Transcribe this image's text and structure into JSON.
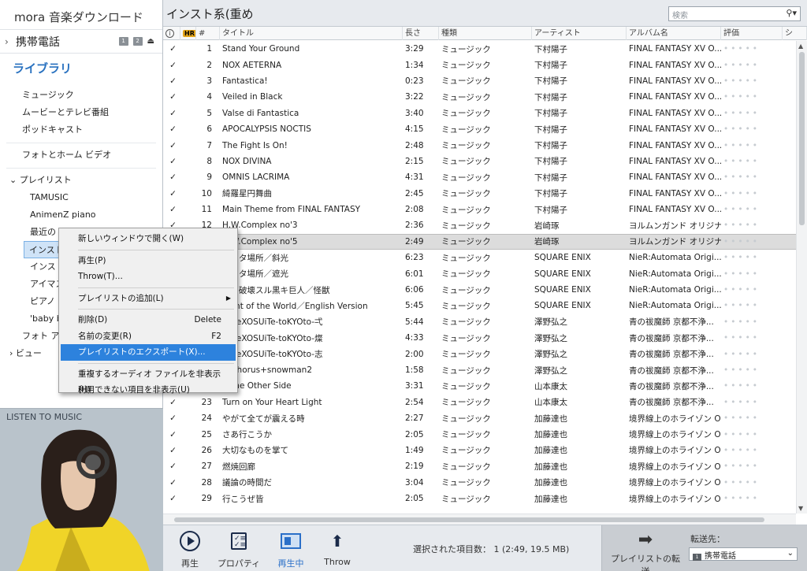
{
  "sidebar": {
    "app_title": "mora 音楽ダウンロード",
    "device": "携帯電話",
    "device_icon_1": "1",
    "device_icon_2": "2",
    "library_heading": "ライブラリ",
    "items": [
      "ミュージック",
      "ムービーとテレビ番組",
      "ポッドキャスト",
      "フォトとホーム ビデオ"
    ],
    "playlist_group": "プレイリスト",
    "playlists": [
      "TAMUSIC",
      "AnimenZ piano",
      "最近の",
      "インスト系",
      "インスト",
      "アイマス",
      "ピアノ",
      "'baby b"
    ],
    "more_items": [
      "フォト アルバ",
      "ビュー"
    ]
  },
  "header": {
    "playlist_title": "インスト系(重め",
    "search_placeholder": "検索"
  },
  "columns": {
    "num": "#",
    "hr": "HR",
    "title": "タイトル",
    "length": "長さ",
    "kind": "種類",
    "artist": "アーティスト",
    "album": "アルバム名",
    "rating": "評価",
    "extra": "シ"
  },
  "tracks": [
    {
      "num": "1",
      "title": "Stand Your Ground",
      "length": "3:29",
      "kind": "ミュージック",
      "artist": "下村陽子",
      "album": "FINAL FANTASY XV O..."
    },
    {
      "num": "2",
      "title": "NOX AETERNA",
      "length": "1:34",
      "kind": "ミュージック",
      "artist": "下村陽子",
      "album": "FINAL FANTASY XV O..."
    },
    {
      "num": "3",
      "title": "Fantastica!",
      "length": "0:23",
      "kind": "ミュージック",
      "artist": "下村陽子",
      "album": "FINAL FANTASY XV O..."
    },
    {
      "num": "4",
      "title": "Veiled in Black",
      "length": "3:22",
      "kind": "ミュージック",
      "artist": "下村陽子",
      "album": "FINAL FANTASY XV O..."
    },
    {
      "num": "5",
      "title": "Valse di Fantastica",
      "length": "3:40",
      "kind": "ミュージック",
      "artist": "下村陽子",
      "album": "FINAL FANTASY XV O..."
    },
    {
      "num": "6",
      "title": "APOCALYPSIS NOCTIS",
      "length": "4:15",
      "kind": "ミュージック",
      "artist": "下村陽子",
      "album": "FINAL FANTASY XV O..."
    },
    {
      "num": "7",
      "title": "The Fight Is On!",
      "length": "2:48",
      "kind": "ミュージック",
      "artist": "下村陽子",
      "album": "FINAL FANTASY XV O..."
    },
    {
      "num": "8",
      "title": "NOX DIVINA",
      "length": "2:15",
      "kind": "ミュージック",
      "artist": "下村陽子",
      "album": "FINAL FANTASY XV O..."
    },
    {
      "num": "9",
      "title": "OMNIS LACRIMA",
      "length": "4:31",
      "kind": "ミュージック",
      "artist": "下村陽子",
      "album": "FINAL FANTASY XV O..."
    },
    {
      "num": "10",
      "title": "綺羅星円舞曲",
      "length": "2:45",
      "kind": "ミュージック",
      "artist": "下村陽子",
      "album": "FINAL FANTASY XV O..."
    },
    {
      "num": "11",
      "title": "Main Theme from FINAL FANTASY",
      "length": "2:08",
      "kind": "ミュージック",
      "artist": "下村陽子",
      "album": "FINAL FANTASY XV O..."
    },
    {
      "num": "12",
      "title": "H.W.Complex no'3",
      "length": "2:36",
      "kind": "ミュージック",
      "artist": "岩崎琢",
      "album": "ヨルムンガンド オリジナル..."
    },
    {
      "num": "",
      "title": "H.W.Complex no'5",
      "length": "2:49",
      "kind": "ミュージック",
      "artist": "岩崎琢",
      "album": "ヨルムンガンド オリジナル..."
    },
    {
      "num": "",
      "title": "サレタ場所／斜光",
      "length": "6:23",
      "kind": "ミュージック",
      "artist": "SQUARE ENIX",
      "album": "NieR:Automata Origi..."
    },
    {
      "num": "",
      "title": "サレタ場所／遮光",
      "length": "6:01",
      "kind": "ミュージック",
      "artist": "SQUARE ENIX",
      "album": "NieR:Automata Origi..."
    },
    {
      "num": "",
      "title": "テラ破壊スル黒キ巨人／怪獣",
      "length": "6:06",
      "kind": "ミュージック",
      "artist": "SQUARE ENIX",
      "album": "NieR:Automata Origi..."
    },
    {
      "num": "",
      "title": "eight of the World／English Version",
      "length": "5:45",
      "kind": "ミュージック",
      "artist": "SQUARE ENIX",
      "album": "NieR:Automata Origi..."
    },
    {
      "num": "",
      "title": "Ue-eXOSUiTe-toKYOto-弌",
      "length": "5:44",
      "kind": "ミュージック",
      "artist": "澤野弘之",
      "album": "青の祓魔師 京都不浄..."
    },
    {
      "num": "",
      "title": "Ue-eXOSUiTe-toKYOto-燦",
      "length": "4:33",
      "kind": "ミュージック",
      "artist": "澤野弘之",
      "album": "青の祓魔師 京都不浄..."
    },
    {
      "num": "",
      "title": "Ue-eXOSUiTe-toKYOto-志",
      "length": "2:00",
      "kind": "ミュージック",
      "artist": "澤野弘之",
      "album": "青の祓魔師 京都不浄..."
    },
    {
      "num": "",
      "title": "osphorus+snowman2",
      "length": "1:58",
      "kind": "ミュージック",
      "artist": "澤野弘之",
      "album": "青の祓魔師 京都不浄..."
    },
    {
      "num": "",
      "title": "N the Other Side",
      "length": "3:31",
      "kind": "ミュージック",
      "artist": "山本康太",
      "album": "青の祓魔師 京都不浄..."
    },
    {
      "num": "23",
      "title": "Turn on Your Heart Light",
      "length": "2:54",
      "kind": "ミュージック",
      "artist": "山本康太",
      "album": "青の祓魔師 京都不浄..."
    },
    {
      "num": "24",
      "title": "やがて全てが震える時",
      "length": "2:27",
      "kind": "ミュージック",
      "artist": "加藤達也",
      "album": "境界線上のホライゾン O..."
    },
    {
      "num": "25",
      "title": "さあ行こうか",
      "length": "2:05",
      "kind": "ミュージック",
      "artist": "加藤達也",
      "album": "境界線上のホライゾン O..."
    },
    {
      "num": "26",
      "title": "大切なものを掌て",
      "length": "1:49",
      "kind": "ミュージック",
      "artist": "加藤達也",
      "album": "境界線上のホライゾン O..."
    },
    {
      "num": "27",
      "title": "燃焼回廊",
      "length": "2:19",
      "kind": "ミュージック",
      "artist": "加藤達也",
      "album": "境界線上のホライゾン O..."
    },
    {
      "num": "28",
      "title": "議論の時間だ",
      "length": "3:04",
      "kind": "ミュージック",
      "artist": "加藤達也",
      "album": "境界線上のホライゾン O..."
    },
    {
      "num": "29",
      "title": "行こうぜ皆",
      "length": "2:05",
      "kind": "ミュージック",
      "artist": "加藤達也",
      "album": "境界線上のホライゾン O..."
    }
  ],
  "context_menu": {
    "items": [
      {
        "label": "新しいウィンドウで開く(W)"
      },
      {
        "label": "再生(P)"
      },
      {
        "label": "Throw(T)..."
      },
      {
        "label": "プレイリストの追加(L)"
      },
      {
        "label": "削除(D)",
        "accel": "Delete"
      },
      {
        "label": "名前の変更(R)",
        "accel": "F2"
      },
      {
        "label": "プレイリストのエクスポート(X)..."
      },
      {
        "label": "重複するオーディオ ファイルを非表示(H)"
      },
      {
        "label": "利用できない項目を非表示(U)"
      }
    ]
  },
  "toolbar": {
    "play": "再生",
    "properties": "プロパティ",
    "now_playing": "再生中",
    "throw": "Throw",
    "status": "選択された項目数： 1 (2:49, 19.5 MB)",
    "transfer": "プレイリストの転送",
    "dest_label": "転送先：",
    "dest_value": "携帯電話"
  },
  "album_art": {
    "text": "LISTEN TO MUSIC"
  }
}
